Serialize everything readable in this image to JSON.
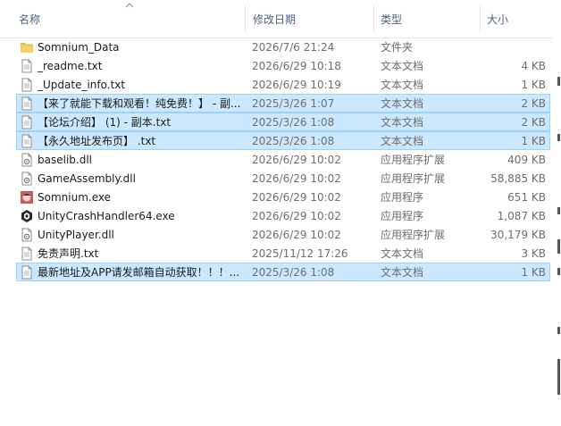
{
  "columns": {
    "name": "名称",
    "date": "修改日期",
    "type": "类型",
    "size": "大小"
  },
  "files": [
    {
      "name": "Somnium_Data",
      "date": "2026/7/6 21:24",
      "type": "文件夹",
      "size": "",
      "icon": "folder-icon",
      "selected": false
    },
    {
      "name": "_readme.txt",
      "date": "2026/6/29 10:18",
      "type": "文本文档",
      "size": "4 KB",
      "icon": "text-file-icon",
      "selected": false
    },
    {
      "name": "_Update_info.txt",
      "date": "2026/6/29 10:19",
      "type": "文本文档",
      "size": "1 KB",
      "icon": "text-file-icon",
      "selected": false
    },
    {
      "name": "【来了就能下载和观看！纯免费！】 - 副...",
      "date": "2025/3/26 1:07",
      "type": "文本文档",
      "size": "2 KB",
      "icon": "text-file-icon",
      "selected": true
    },
    {
      "name": "【论坛介绍】 (1) - 副本.txt",
      "date": "2025/3/26 1:08",
      "type": "文本文档",
      "size": "2 KB",
      "icon": "text-file-icon",
      "selected": true
    },
    {
      "name": "【永久地址发布页】 .txt",
      "date": "2025/3/26 1:08",
      "type": "文本文档",
      "size": "1 KB",
      "icon": "text-file-icon",
      "selected": true
    },
    {
      "name": "baselib.dll",
      "date": "2026/6/29 10:02",
      "type": "应用程序扩展",
      "size": "409 KB",
      "icon": "dll-file-icon",
      "selected": false
    },
    {
      "name": "GameAssembly.dll",
      "date": "2026/6/29 10:02",
      "type": "应用程序扩展",
      "size": "58,885 KB",
      "icon": "dll-file-icon",
      "selected": false
    },
    {
      "name": "Somnium.exe",
      "date": "2026/6/29 10:02",
      "type": "应用程序",
      "size": "651 KB",
      "icon": "somnium-app-icon",
      "selected": false
    },
    {
      "name": "UnityCrashHandler64.exe",
      "date": "2026/6/29 10:02",
      "type": "应用程序",
      "size": "1,087 KB",
      "icon": "unity-app-icon",
      "selected": false
    },
    {
      "name": "UnityPlayer.dll",
      "date": "2026/6/29 10:02",
      "type": "应用程序扩展",
      "size": "30,179 KB",
      "icon": "dll-file-icon",
      "selected": false
    },
    {
      "name": "免责声明.txt",
      "date": "2025/11/12 17:26",
      "type": "文本文档",
      "size": "3 KB",
      "icon": "text-file-icon",
      "selected": false
    },
    {
      "name": "最新地址及APP请发邮箱自动获取！！！...",
      "date": "2025/3/26 1:08",
      "type": "文本文档",
      "size": "1 KB",
      "icon": "text-file-icon",
      "selected": true
    }
  ],
  "colors": {
    "selection_bg": "#cce8ff",
    "selection_border": "#99d1ff",
    "header_text": "#4d6082",
    "folder": "#e8b84a"
  }
}
